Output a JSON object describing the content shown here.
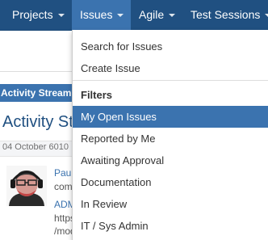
{
  "topnav": {
    "items": [
      {
        "label": "Projects",
        "active": false
      },
      {
        "label": "Issues",
        "active": true
      },
      {
        "label": "Agile",
        "active": false
      },
      {
        "label": "Test Sessions",
        "active": false
      }
    ]
  },
  "dropdown": {
    "items": [
      "Search for Issues",
      "Create Issue"
    ],
    "filters_heading": "Filters",
    "filters": [
      "My Open Issues",
      "Reported by Me",
      "Awaiting Approval",
      "Documentation",
      "In Review",
      "IT / Sys Admin"
    ],
    "selected": "My Open Issues"
  },
  "background": {
    "tab_label": "Activity Stream",
    "title": "Activity Stre",
    "date": "04 October 6010",
    "entry": {
      "author": "Paul",
      "line2": "com",
      "link": "ADM",
      "line4": "https",
      "line5": "/mod"
    }
  },
  "colors": {
    "nav_bg": "#205081",
    "nav_active": "#3b73af",
    "menu_selected": "#3b73af",
    "link": "#3b73af"
  }
}
